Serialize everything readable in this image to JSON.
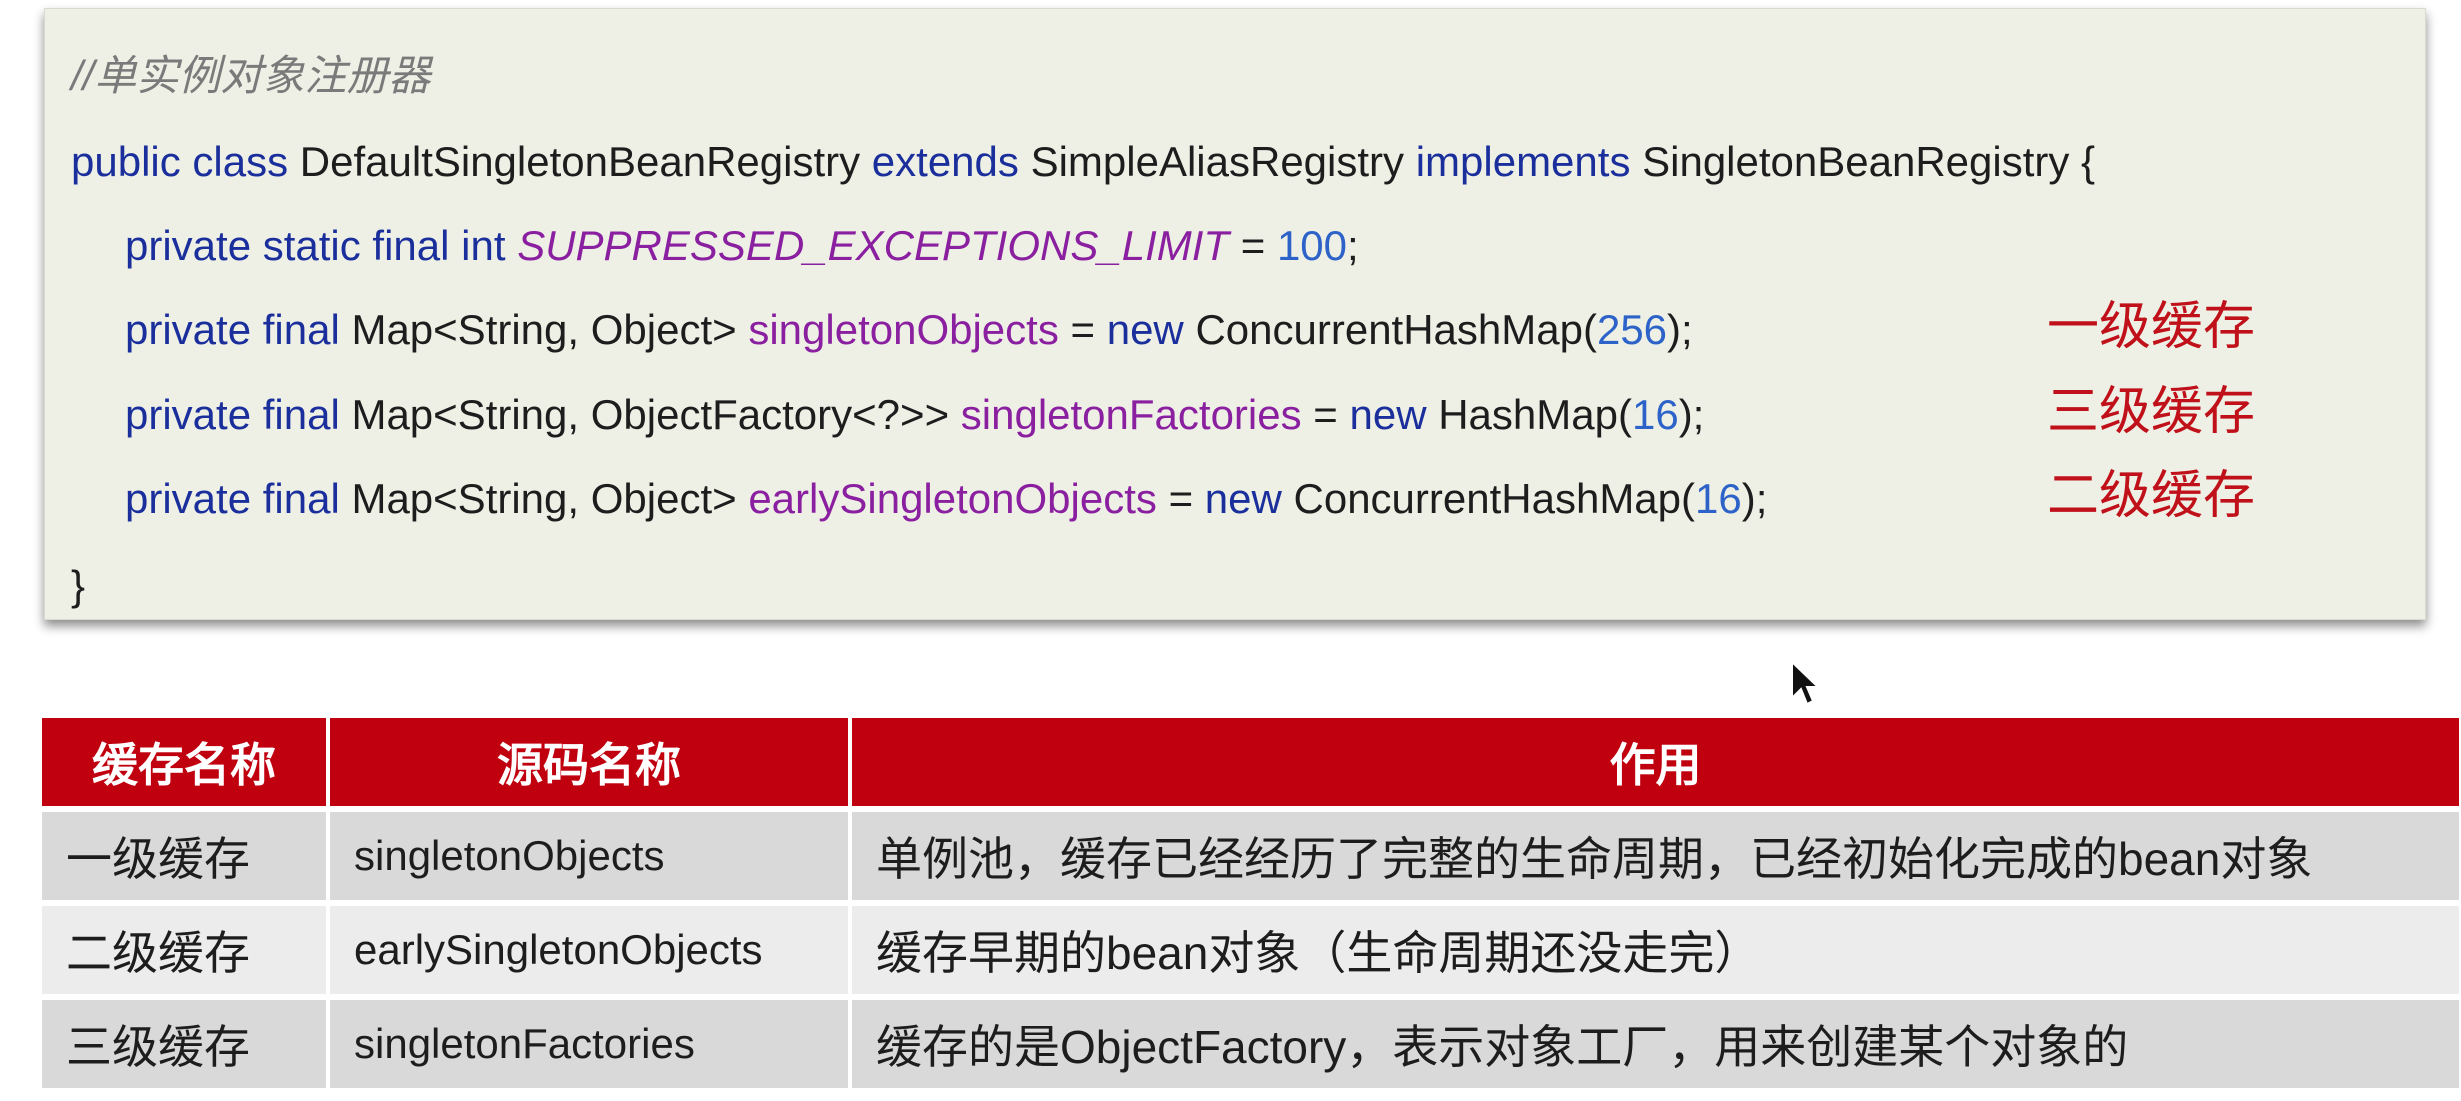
{
  "code": {
    "comment": "//单实例对象注册器",
    "class_decl": {
      "kw_public_class": "public class",
      "class_name": "DefaultSingletonBeanRegistry",
      "kw_extends": "extends",
      "parent": "SimpleAliasRegistry",
      "kw_implements": "implements",
      "iface": "SingletonBeanRegistry {"
    },
    "line_limit": {
      "modifiers": "private static final int",
      "name": "SUPPRESSED_EXCEPTIONS_LIMIT",
      "eq": "=",
      "value": "100",
      "end": ";"
    },
    "line_singleton_objects": {
      "modifiers": "private final",
      "type": "Map<String, Object>",
      "name": "singletonObjects",
      "eq": "=",
      "kw_new": "new",
      "ctor": "ConcurrentHashMap(",
      "arg": "256",
      "end": ");"
    },
    "line_singleton_factories": {
      "modifiers": "private final",
      "type": "Map<String, ObjectFactory<?>>",
      "name": "singletonFactories",
      "eq": "=",
      "kw_new": "new",
      "ctor": "HashMap(",
      "arg": "16",
      "end": ");"
    },
    "line_early_objects": {
      "modifiers": "private final",
      "type": "Map<String, Object>",
      "name": "earlySingletonObjects",
      "eq": "=",
      "kw_new": "new",
      "ctor": "ConcurrentHashMap(",
      "arg": "16",
      "end": ");"
    },
    "closing_brace": "}"
  },
  "notes": {
    "first": "一级缓存",
    "third": "三级缓存",
    "second": "二级缓存"
  },
  "table": {
    "headers": [
      "缓存名称",
      "源码名称",
      "作用"
    ],
    "rows": [
      {
        "level": "一级缓存",
        "source": "singletonObjects",
        "purpose": "单例池，缓存已经经历了完整的生命周期，已经初始化完成的bean对象"
      },
      {
        "level": "二级缓存",
        "source": "earlySingletonObjects",
        "purpose": "缓存早期的bean对象（生命周期还没走完）"
      },
      {
        "level": "三级缓存",
        "source": "singletonFactories",
        "purpose": "缓存的是ObjectFactory，表示对象工厂，用来创建某个对象的"
      }
    ]
  },
  "colors": {
    "keyword": "#1a2f9c",
    "field": "#8a1fa0",
    "number": "#2d63c8",
    "note": "#c0101a",
    "table_header": "#c0000f"
  }
}
